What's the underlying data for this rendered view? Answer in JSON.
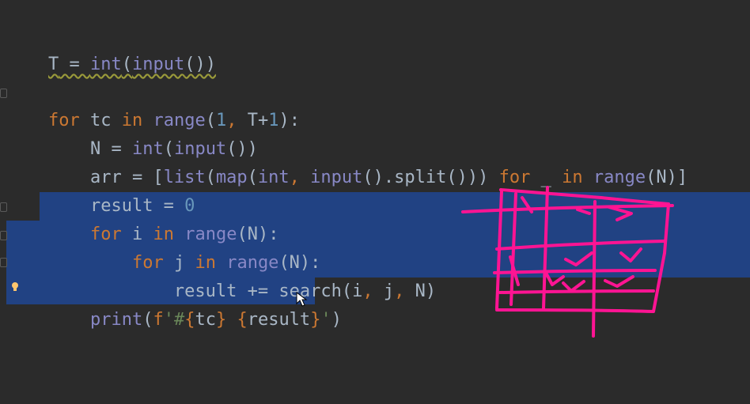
{
  "editor": {
    "lines": [
      {
        "id": "line-1"
      },
      {
        "id": "line-3"
      }
    ]
  },
  "code": {
    "l1": {
      "a": "T",
      "b": " = ",
      "c": "int",
      "d": "(",
      "e": "input",
      "f": "())"
    },
    "l3": {
      "kw_for": "for",
      "t1": " tc ",
      "kw_in": "in",
      "sp": " ",
      "range": "range",
      "p1": "(",
      "one": "1",
      ", ": ", ",
      "t2": "T+",
      "one2": "1",
      "end": "):"
    },
    "l4": {
      "t1": "    N = ",
      "int": "int",
      "p": "(",
      "input": "input",
      "end": "())"
    },
    "l5": {
      "t1": "    arr = [",
      "list": "list",
      "p1": "(",
      "map": "map",
      "p2": "(",
      "int": "int",
      ", ": ", ",
      "input": "input",
      "t2": "().split())) ",
      "for": "for",
      "t3": " _ ",
      "in": "in",
      "sp": " ",
      "range": "range",
      "end": "(N)]"
    },
    "l6": {
      "t1": "    result = ",
      "zero": "0"
    },
    "l7": {
      "t1": "    ",
      "for": "for",
      "t2": " i ",
      "in": "in",
      "sp": " ",
      "range": "range",
      "end": "(N):"
    },
    "l8": {
      "t1": "        ",
      "for": "for",
      "t2": " j ",
      "in": "in",
      "sp": " ",
      "range": "range",
      "end": "(N):"
    },
    "l9": {
      "t1": "            result += search(i",
      "c1": ",",
      "t2": " j",
      "c2": ",",
      "t3": " N)"
    },
    "l10": {
      "t1": "    ",
      "print": "print",
      "t2": "(",
      "f": "f",
      "q": "'#",
      "b1": "{",
      "tc": "tc",
      "b2": "}",
      "sp": " ",
      "b3": "{",
      "res": "result",
      "b4": "}",
      "q2": "'",
      ")": ")"
    }
  },
  "colors": {
    "background": "#2b2b2b",
    "selection": "#214283",
    "keyword": "#cc7832",
    "builtin": "#8888c6",
    "number": "#6897bb",
    "text": "#a9b7c6",
    "annotation": "#ff1493"
  },
  "icons": {
    "bulb": "lightbulb-icon",
    "cursor": "mouse-cursor-icon"
  }
}
